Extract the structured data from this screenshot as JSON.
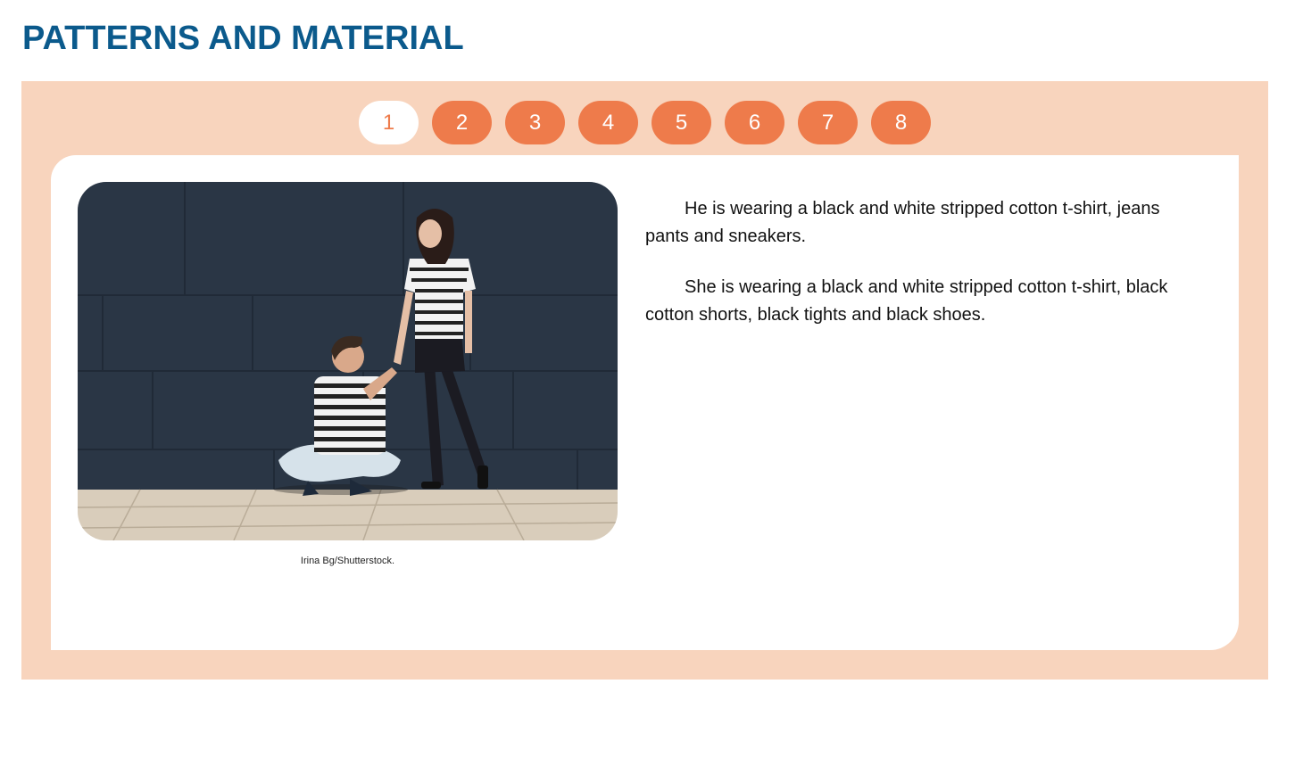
{
  "title": "PATTERNS AND MATERIAL",
  "tabs": [
    {
      "label": "1",
      "active": true
    },
    {
      "label": "2",
      "active": false
    },
    {
      "label": "3",
      "active": false
    },
    {
      "label": "4",
      "active": false
    },
    {
      "label": "5",
      "active": false
    },
    {
      "label": "6",
      "active": false
    },
    {
      "label": "7",
      "active": false
    },
    {
      "label": "8",
      "active": false
    }
  ],
  "slide": {
    "photo_credit": "Irina Bg/Shutterstock.",
    "paragraphs": [
      "He is wearing a black and white stripped cotton t-shirt, jeans pants and sneakers.",
      "She is wearing a black and white stripped cotton t-shirt, black cotton shorts, black tights and black shoes."
    ]
  },
  "colors": {
    "title": "#0b5a8c",
    "panel": "#f8d4bd",
    "tab": "#ee7b4b",
    "tab_active_bg": "#ffffff"
  }
}
